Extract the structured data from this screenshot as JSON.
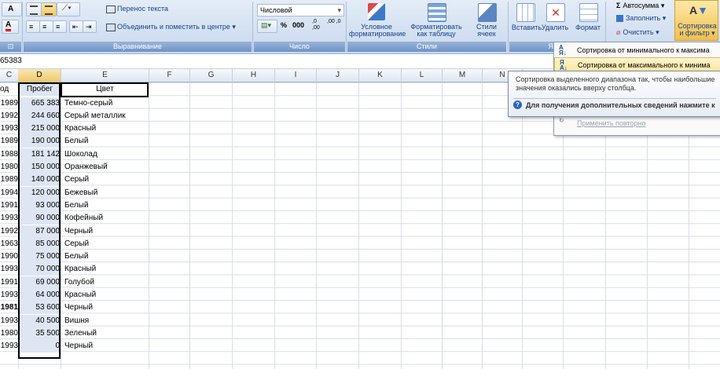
{
  "ribbon": {
    "wrap_text": "Перенос текста",
    "merge_center": "Объединить и поместить в центре",
    "align_group": "Выравнивание",
    "number_format": "Числовой",
    "percent": "%",
    "thousands": "000",
    "dec_inc": ",0 ,00",
    "dec_dec": ",00 ,0",
    "number_group": "Число",
    "cond_format_l1": "Условное",
    "cond_format_l2": "форматирование",
    "format_table_l1": "Форматировать",
    "format_table_l2": "как таблицу",
    "cell_styles_l1": "Стили",
    "cell_styles_l2": "ячеек",
    "styles_group": "Стили",
    "insert": "Вставить",
    "delete": "Удалить",
    "format": "Формат",
    "cells_group_partial": "Я",
    "autosum": "Автосумма",
    "fill": "Заполнить",
    "clear": "Очистить",
    "sort_filter_l1": "Сортировка",
    "sort_filter_l2": "и фильтр",
    "font_size_label": "A",
    "font_color_label": "A"
  },
  "formula_bar": {
    "value": "65383"
  },
  "columns": [
    "C",
    "D",
    "E",
    "F",
    "G",
    "H",
    "I",
    "J",
    "K",
    "L",
    "M",
    "N"
  ],
  "table": {
    "headers": {
      "year": "од",
      "mileage": "Пробег",
      "color": "Цвет"
    },
    "rows": [
      {
        "year": "1989",
        "mileage": "665 383",
        "color": "Темно-серый"
      },
      {
        "year": "1992",
        "mileage": "244 660",
        "color": "Серый металлик"
      },
      {
        "year": "1993",
        "mileage": "215 000",
        "color": "Красный"
      },
      {
        "year": "1989",
        "mileage": "190 000",
        "color": "Белый"
      },
      {
        "year": "1988",
        "mileage": "181 142",
        "color": "Шоколад"
      },
      {
        "year": "1980",
        "mileage": "150 000",
        "color": "Оранжевый"
      },
      {
        "year": "1989",
        "mileage": "140 000",
        "color": "Серый"
      },
      {
        "year": "1994",
        "mileage": "120 000",
        "color": "Бежевый"
      },
      {
        "year": "1991",
        "mileage": "93 000",
        "color": "Белый"
      },
      {
        "year": "1993",
        "mileage": "90 000",
        "color": "Кофейный"
      },
      {
        "year": "1992",
        "mileage": "87 000",
        "color": "Черный"
      },
      {
        "year": "1963",
        "mileage": "85 000",
        "color": "Серый"
      },
      {
        "year": "1990",
        "mileage": "75 000",
        "color": "Белый"
      },
      {
        "year": "1993",
        "mileage": "70 000",
        "color": "Красный"
      },
      {
        "year": "1991",
        "mileage": "69 000",
        "color": "Голубой"
      },
      {
        "year": "1993",
        "mileage": "64 000",
        "color": "Красный"
      },
      {
        "year": "1981",
        "mileage": "53 600",
        "color": "Черный"
      },
      {
        "year": "1993",
        "mileage": "40 500",
        "color": "Вишня"
      },
      {
        "year": "1980",
        "mileage": "35 500",
        "color": "Зеленый"
      },
      {
        "year": "1993",
        "mileage": "0",
        "color": "Черный"
      }
    ]
  },
  "sort_menu": {
    "asc": "Сортировка от минимального к максима",
    "desc": "Сортировка от максимального к минима",
    "reapply": "Применить повторно"
  },
  "tooltip": {
    "description": "Сортировка выделенного диапазона так, чтобы наибольшие значения оказались вверху столбца.",
    "help": "Для получения дополнительных сведений нажмите к"
  },
  "colors": {
    "accent": "#f0c96a",
    "ribbon": "#c9d9ee",
    "selection": "#dde6f2"
  }
}
